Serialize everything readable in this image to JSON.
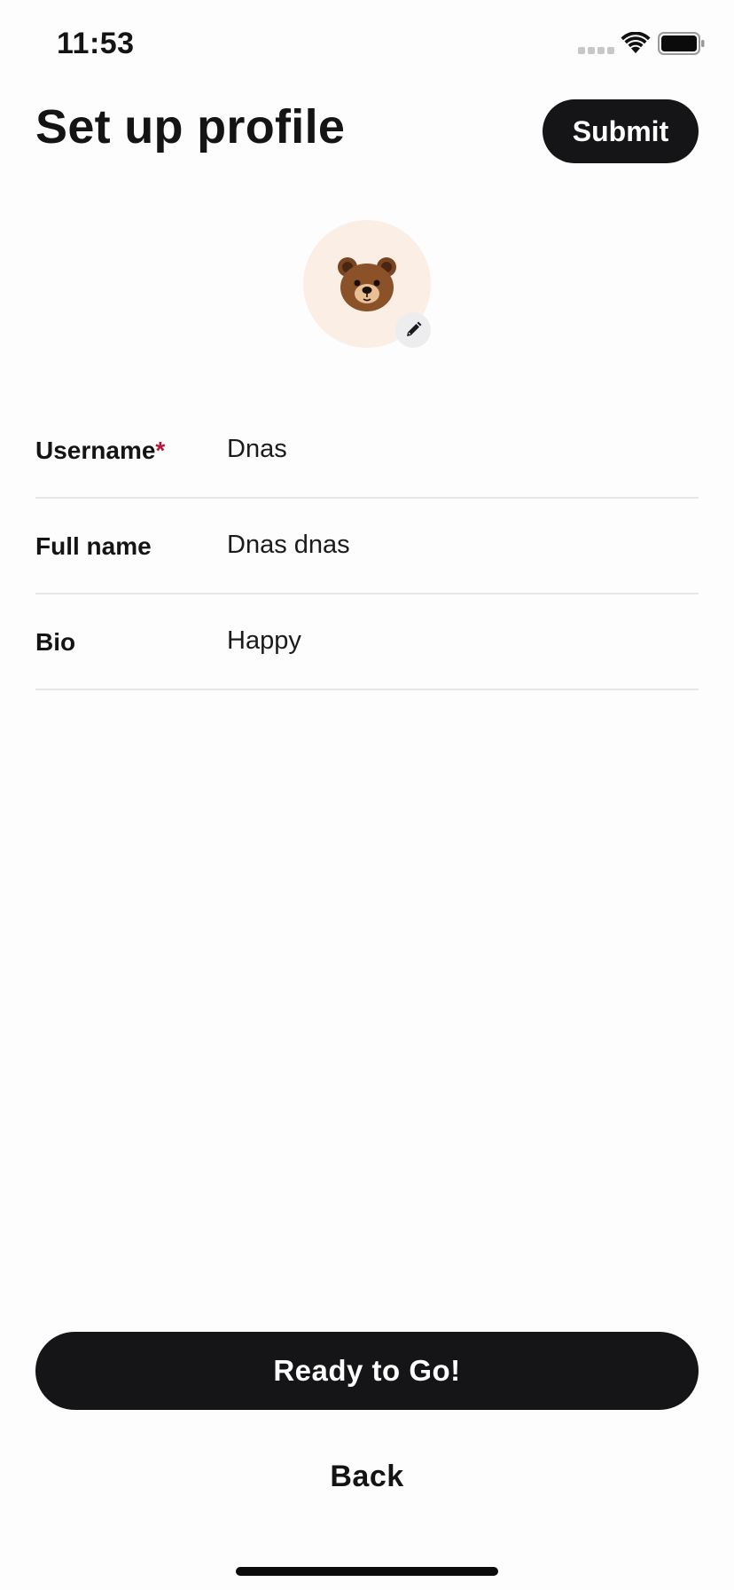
{
  "status_bar": {
    "time": "11:53",
    "wifi_icon": "wifi-icon",
    "battery_icon": "battery-full-icon"
  },
  "header": {
    "title": "Set up profile",
    "submit_label": "Submit"
  },
  "avatar": {
    "emoji_icon": "bear-face-icon",
    "edit_icon": "pencil-icon",
    "background_color": "#fbeee5"
  },
  "form": {
    "fields": [
      {
        "label": "Username",
        "required_mark": "*",
        "value": "Dnas"
      },
      {
        "label": "Full name",
        "value": "Dnas dnas"
      },
      {
        "label": "Bio",
        "value": "Happy"
      }
    ]
  },
  "actions": {
    "primary_label": "Ready to Go!",
    "secondary_label": "Back"
  },
  "colors": {
    "primary_button": "#151517",
    "required_mark": "#b0173a"
  }
}
